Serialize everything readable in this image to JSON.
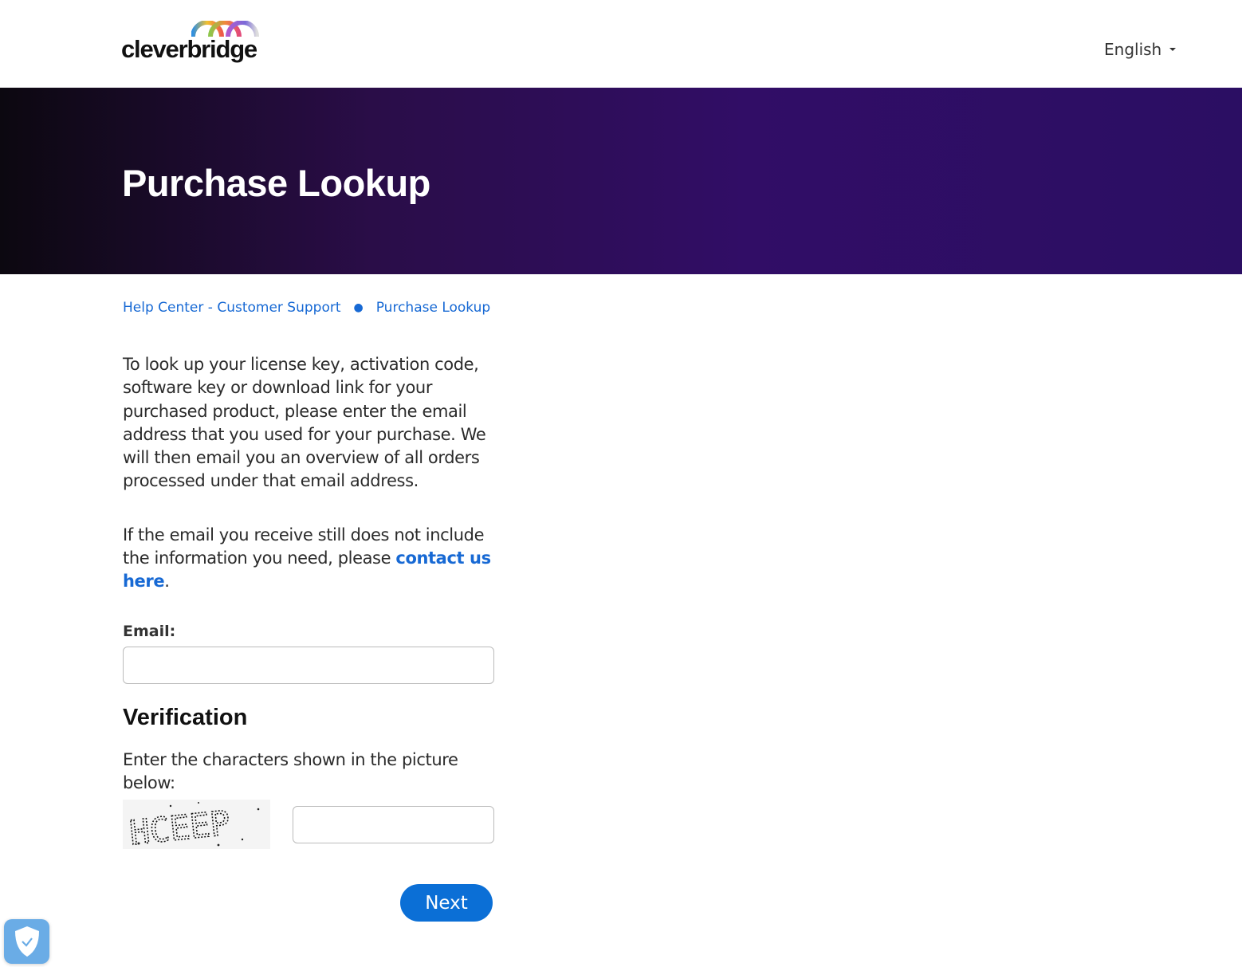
{
  "header": {
    "logo_text": "cleverbridge",
    "language": "English"
  },
  "hero": {
    "title": "Purchase Lookup"
  },
  "breadcrumb": [
    {
      "label": "Help Center - Customer Support"
    },
    {
      "label": "Purchase Lookup"
    }
  ],
  "intro": "To look up your license key, activation code, software key or download link for your purchased product, please enter the email address that you used for your purchase. We will then email you an overview of all orders processed under that email address.",
  "contact": {
    "text": "If the email you receive still does not include the information you need, please ",
    "link": "contact us here",
    "after": "."
  },
  "form": {
    "email_label": "Email:",
    "email_value": "",
    "verification_title": "Verification",
    "verification_text": "Enter the characters shown in the picture below:",
    "captcha_text": "HCEEP",
    "captcha_value": "",
    "next_label": "Next"
  },
  "colors": {
    "accent": "#0b6fd6",
    "link": "#1769d4",
    "hero_start": "#0c0810",
    "hero_end": "#310d66"
  },
  "icons": {
    "language": "caret-down-icon",
    "privacy": "shield-check-icon"
  }
}
